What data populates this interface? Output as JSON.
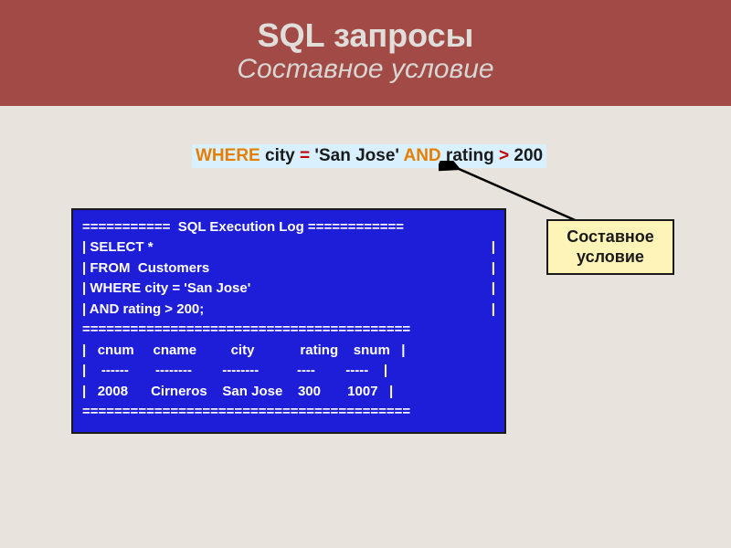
{
  "header": {
    "title_main": "SQL запросы",
    "title_sub": "Составное условие"
  },
  "where_clause": {
    "kw_where": "WHERE",
    "txt_1": "  city ",
    "eq": "=",
    "txt_2": " 'San Jose' ",
    "kw_and": "AND",
    "txt_3": " rating ",
    "gt": ">",
    "txt_4": " 200"
  },
  "log": {
    "divider_top": "===========  SQL Execution Log ============",
    "select": "| SELECT *",
    "from": "| FROM  Customers",
    "where": "| WHERE city = 'San Jose'",
    "and": "| AND rating > 200;",
    "pipe": "|",
    "divider_mid": "=========================================",
    "row_header": "|   cnum     cname         city            rating    snum   |",
    "row_dash": "|    ------       --------        --------          ----        -----    |",
    "row_data": "|   2008      Cirneros    San Jose    300       1007   |",
    "divider_bot": "========================================="
  },
  "callout": {
    "line1": "Составное",
    "line2": "условие"
  }
}
